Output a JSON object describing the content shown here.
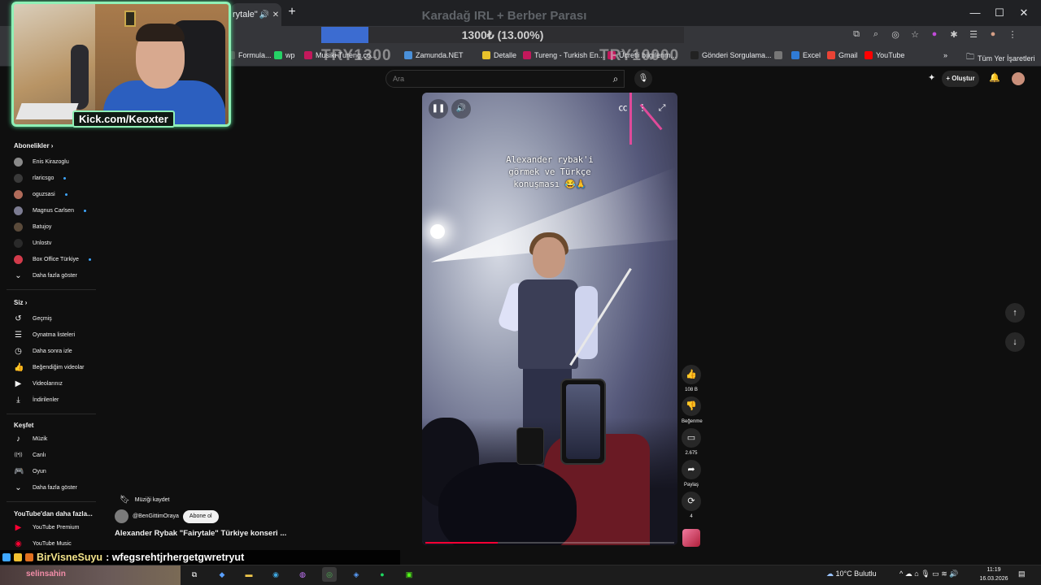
{
  "browser": {
    "tab_title": "rytale\"",
    "overlay_title": "Karadağ IRL + Berber Parası",
    "donation_text": "1300₺ (13.00%)",
    "donation_progress": 0.13,
    "ghost_left": "TRY1300",
    "ghost_right": "TRY10000"
  },
  "bookmarks": [
    {
      "label": "Formula...",
      "icon": "formula-icon",
      "color": "#555555"
    },
    {
      "label": "wp",
      "icon": "whatsapp-icon",
      "color": "#25d366"
    },
    {
      "label": "Musiki Tureng.co...",
      "icon": "tureng-icon",
      "color": "#c2185b"
    },
    {
      "label": "Zamunda.NET",
      "icon": "zamunda-icon",
      "color": "#4a90d9"
    },
    {
      "label": "Detalle",
      "icon": "folder-icon",
      "color": "#e8c22b"
    },
    {
      "label": "Tureng - Turkish En...",
      "icon": "tureng-icon",
      "color": "#c2185b"
    },
    {
      "label": "Ücretli bilgilerim...",
      "icon": "tureng-icon",
      "color": "#c2185b"
    },
    {
      "label": "Gönderi Sorgulama...",
      "icon": "x-icon",
      "color": "#222222"
    },
    {
      "label": "",
      "icon": "globe-icon",
      "color": "#777777"
    },
    {
      "label": "Excel",
      "icon": "edge-icon",
      "color": "#2f7bd6"
    },
    {
      "label": "Gmail",
      "icon": "gmail-icon",
      "color": "#ea4335"
    },
    {
      "label": "YouTube",
      "icon": "youtube-icon",
      "color": "#ff0000"
    }
  ],
  "all_bookmarks_label": "Tüm Yer İşaretleri",
  "youtube": {
    "search_placeholder": "Ara",
    "create_label": "Oluştur"
  },
  "webcam_label": "Kick.com/Keoxter",
  "sidebar": {
    "subscriptions_title": "Abonelikler",
    "subscriptions": [
      {
        "label": "Enis Kirazoglu",
        "live": false,
        "color": "#8a8a8a"
      },
      {
        "label": "rlaricsgo",
        "live": true,
        "color": "#3a3a3a"
      },
      {
        "label": "oguzsasi",
        "live": true,
        "color": "#b06b5a"
      },
      {
        "label": "Magnus Carlsen",
        "live": true,
        "color": "#7c7c92"
      },
      {
        "label": "Batujoy",
        "live": false,
        "color": "#5a4a3a"
      },
      {
        "label": "Unlostv",
        "live": false,
        "color": "#2a2a2a"
      },
      {
        "label": "Box Office Türkiye",
        "live": true,
        "color": "#d23b4b"
      }
    ],
    "subs_more": "Daha fazla göster",
    "you_title": "Siz",
    "you_items": [
      {
        "label": "Geçmiş",
        "icon": "history-icon"
      },
      {
        "label": "Oynatma listeleri",
        "icon": "playlist-icon"
      },
      {
        "label": "Daha sonra izle",
        "icon": "clock-icon"
      },
      {
        "label": "Beğendiğim videolar",
        "icon": "like-icon"
      },
      {
        "label": "Videolarınız",
        "icon": "video-icon"
      },
      {
        "label": "İndirilenler",
        "icon": "download-icon"
      }
    ],
    "explore_title": "Keşfet",
    "explore_items": [
      {
        "label": "Müzik",
        "icon": "music-icon"
      },
      {
        "label": "Canlı",
        "icon": "live-icon"
      },
      {
        "label": "Oyun",
        "icon": "game-icon"
      }
    ],
    "explore_more": "Daha fazla göster",
    "more_yt_title": "YouTube'dan daha fazla...",
    "more_yt_items": [
      {
        "label": "YouTube Premium"
      },
      {
        "label": "YouTube Music"
      }
    ]
  },
  "short": {
    "caption": "Alexander rybak'i\ngörmek ve Türkçe\nkonuşması 😂🙏",
    "progress": 0.29,
    "likes": "108 B",
    "dislike_label": "Beğenme",
    "comments": "2.675",
    "share_label": "Paylaş",
    "remix_count": "4",
    "save_music_label": "Müziği kaydet",
    "channel": "@BenGittimOraya",
    "subscribe_label": "Abone ol",
    "title": "Alexander Rybak \"Fairytale\" Türkiye konseri ..."
  },
  "chat": {
    "user": "BirVisneSuyu",
    "message": " : wfegsrehtjrhergetgwretryut"
  },
  "taskbar": {
    "search_text": "selinsahin",
    "weather": "10°C  Bulutlu",
    "time": "11:19",
    "date": "16.03.2026"
  }
}
